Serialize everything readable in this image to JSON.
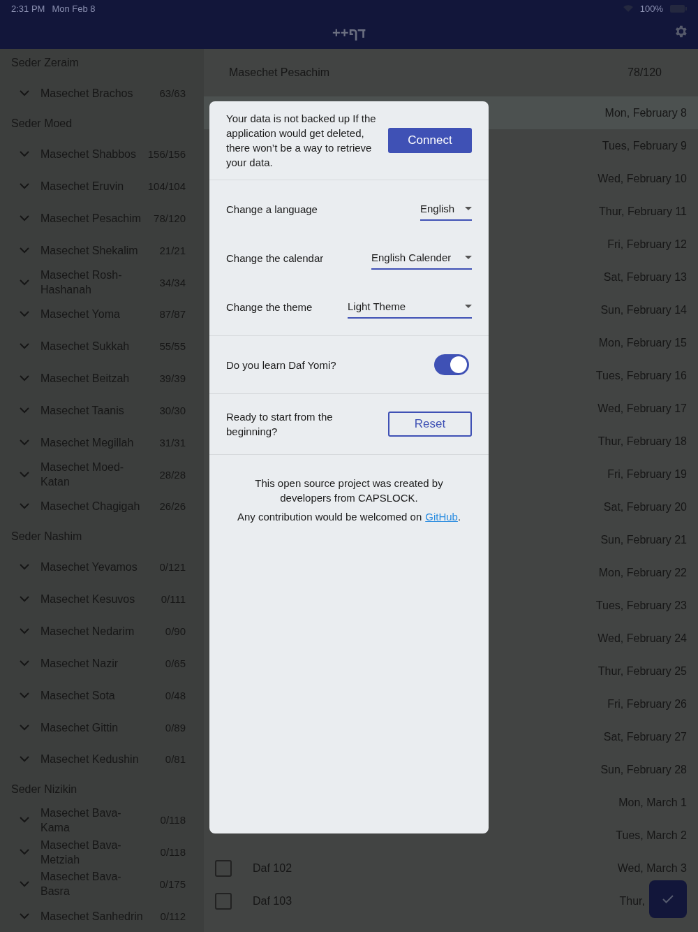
{
  "status_bar": {
    "time": "2:31 PM",
    "date": "Mon Feb 8",
    "battery": "100%"
  },
  "app_bar": {
    "title": "דף++"
  },
  "sidebar": {
    "sections": [
      {
        "title": "Seder Zeraim",
        "items": [
          {
            "name": "Masechet Brachos",
            "count": "63/63"
          }
        ]
      },
      {
        "title": "Seder Moed",
        "items": [
          {
            "name": "Masechet Shabbos",
            "count": "156/156"
          },
          {
            "name": "Masechet Eruvin",
            "count": "104/104"
          },
          {
            "name": "Masechet Pesachim",
            "count": "78/120"
          },
          {
            "name": "Masechet Shekalim",
            "count": "21/21"
          },
          {
            "name": "Masechet Rosh-Hashanah",
            "count": "34/34"
          },
          {
            "name": "Masechet Yoma",
            "count": "87/87"
          },
          {
            "name": "Masechet Sukkah",
            "count": "55/55"
          },
          {
            "name": "Masechet Beitzah",
            "count": "39/39"
          },
          {
            "name": "Masechet Taanis",
            "count": "30/30"
          },
          {
            "name": "Masechet Megillah",
            "count": "31/31"
          },
          {
            "name": "Masechet Moed-Katan",
            "count": "28/28"
          },
          {
            "name": "Masechet Chagigah",
            "count": "26/26"
          }
        ]
      },
      {
        "title": "Seder Nashim",
        "items": [
          {
            "name": "Masechet Yevamos",
            "count": "0/121"
          },
          {
            "name": "Masechet Kesuvos",
            "count": "0/111"
          },
          {
            "name": "Masechet Nedarim",
            "count": "0/90"
          },
          {
            "name": "Masechet Nazir",
            "count": "0/65"
          },
          {
            "name": "Masechet Sota",
            "count": "0/48"
          },
          {
            "name": "Masechet Gittin",
            "count": "0/89"
          },
          {
            "name": "Masechet Kedushin",
            "count": "0/81"
          }
        ]
      },
      {
        "title": "Seder Nizikin",
        "items": [
          {
            "name": "Masechet Bava-Kama",
            "count": "0/118"
          },
          {
            "name": "Masechet Bava-Metziah",
            "count": "0/118"
          },
          {
            "name": "Masechet Bava-Basra",
            "count": "0/175"
          },
          {
            "name": "Masechet Sanhedrin",
            "count": "0/112"
          }
        ]
      }
    ]
  },
  "main": {
    "title": "Masechet Pesachim",
    "count": "78/120",
    "rows": [
      {
        "date": "Mon, February 8",
        "selected": true
      },
      {
        "date": "Tues, February 9",
        "selected": false
      },
      {
        "date": "Wed, February 10",
        "selected": false
      },
      {
        "date": "Thur, February 11",
        "selected": false
      },
      {
        "date": "Fri, February 12",
        "selected": false
      },
      {
        "date": "Sat, February 13",
        "selected": false
      },
      {
        "date": "Sun, February 14",
        "selected": false
      },
      {
        "date": "Mon, February 15",
        "selected": false
      },
      {
        "date": "Tues, February 16",
        "selected": false
      },
      {
        "date": "Wed, February 17",
        "selected": false
      },
      {
        "date": "Thur, February 18",
        "selected": false
      },
      {
        "date": "Fri, February 19",
        "selected": false
      },
      {
        "date": "Sat, February 20",
        "selected": false
      },
      {
        "date": "Sun, February 21",
        "selected": false
      },
      {
        "date": "Mon, February 22",
        "selected": false
      },
      {
        "date": "Tues, February 23",
        "selected": false
      },
      {
        "date": "Wed, February 24",
        "selected": false
      },
      {
        "date": "Thur, February 25",
        "selected": false
      },
      {
        "date": "Fri, February 26",
        "selected": false
      },
      {
        "date": "Sat, February 27",
        "selected": false
      },
      {
        "date": "Sun, February 28",
        "selected": false
      },
      {
        "date": "Mon, March 1",
        "selected": false
      },
      {
        "date": "Tues, March 2",
        "selected": false
      },
      {
        "date": "Wed, March 3",
        "selected": false,
        "daf": "Daf 102",
        "checked": false
      },
      {
        "date": "Thur,",
        "selected": false,
        "daf": "Daf 103",
        "checked": false
      }
    ]
  },
  "dialog": {
    "backup_text": "Your data is not backed up If the application would get deleted, there won’t be a way to retrieve your data.",
    "connect_button": "Connect",
    "settings": [
      {
        "label": "Change a language",
        "value": "English"
      },
      {
        "label": "Change the calendar",
        "value": "English Calender"
      },
      {
        "label": "Change the theme",
        "value": "Light Theme"
      }
    ],
    "daf_yomi": {
      "label": "Do you learn Daf Yomi?",
      "on": true
    },
    "reset": {
      "label": "Ready to start from the beginning?",
      "button": "Reset"
    },
    "credits": "This open source project was created by developers from CAPSLOCK.",
    "contribution": "Any contribution would be welcomed on",
    "link": "GitHub",
    "period": "."
  }
}
